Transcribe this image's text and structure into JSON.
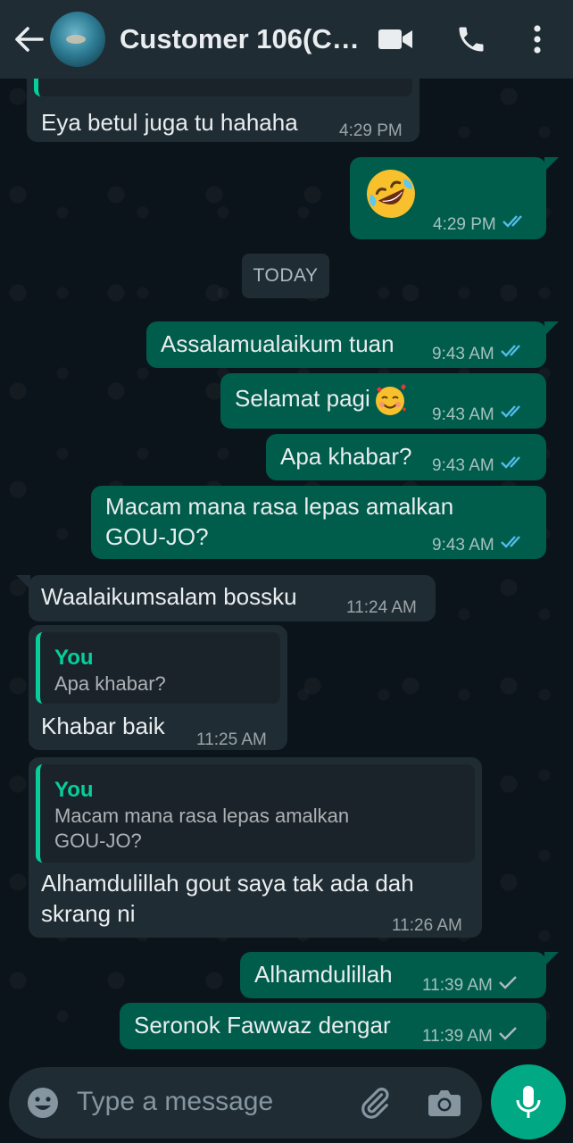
{
  "header": {
    "contact_name": "Customer 106(Ci..."
  },
  "colors": {
    "header_bg": "#1f2c34",
    "incoming_bubble": "#1f2c34",
    "outgoing_bubble": "#005c4b",
    "accent": "#00a884",
    "read_tick": "#53bdeb"
  },
  "messages": {
    "m0": {
      "text": "Eya betul juga tu hahaha",
      "time": "4:29 PM"
    },
    "m1": {
      "emoji": "rolling-on-floor-laughing",
      "time": "4:29 PM",
      "status": "read"
    },
    "date_separator": "TODAY",
    "m2": {
      "text": "Assalamualaikum tuan",
      "time": "9:43 AM",
      "status": "read"
    },
    "m3": {
      "text": "Selamat pagi",
      "emoji": "smiling-face-with-hearts",
      "time": "9:43 AM",
      "status": "read"
    },
    "m4": {
      "text": "Apa khabar?",
      "time": "9:43 AM",
      "status": "read"
    },
    "m5": {
      "line1": "Macam mana rasa lepas amalkan",
      "line2": "GOU-JO?",
      "time": "9:43 AM",
      "status": "read"
    },
    "m6": {
      "text": "Waalaikumsalam bossku",
      "time": "11:24 AM"
    },
    "m7": {
      "quote_author": "You",
      "quote_text": "Apa khabar?",
      "text": "Khabar baik",
      "time": "11:25 AM"
    },
    "m8": {
      "quote_author": "You",
      "quote_line1": "Macam mana rasa lepas amalkan",
      "quote_line2": "GOU-JO?",
      "line1": "Alhamdulillah gout saya tak ada dah",
      "line2": "skrang ni",
      "time": "11:26 AM"
    },
    "m9": {
      "text": "Alhamdulillah",
      "time": "11:39 AM",
      "status": "sent"
    },
    "m10": {
      "text": "Seronok Fawwaz dengar",
      "time": "11:39 AM",
      "status": "sent"
    }
  },
  "composer": {
    "placeholder": "Type a message"
  }
}
